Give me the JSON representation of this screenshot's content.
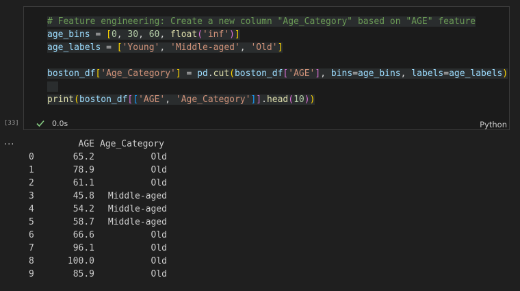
{
  "cell": {
    "execution_count": "[33]",
    "status_time": "0.0s",
    "language": "Python",
    "code_lines": [
      [
        {
          "t": "# Feature engineering: Create a new column \"Age_Category\" based on \"AGE\" feature",
          "c": "c-comment hl"
        }
      ],
      [
        {
          "t": "age_bins",
          "c": "c-var hl"
        },
        {
          "t": " = ",
          "c": "c-op hl"
        },
        {
          "t": "[",
          "c": "c-br1 hl"
        },
        {
          "t": "0",
          "c": "c-num hl"
        },
        {
          "t": ", ",
          "c": "c-op hl"
        },
        {
          "t": "30",
          "c": "c-num hl"
        },
        {
          "t": ", ",
          "c": "c-op hl"
        },
        {
          "t": "60",
          "c": "c-num hl"
        },
        {
          "t": ", ",
          "c": "c-op hl"
        },
        {
          "t": "float",
          "c": "c-fn hl"
        },
        {
          "t": "(",
          "c": "c-br2 hl"
        },
        {
          "t": "'inf'",
          "c": "c-str hl"
        },
        {
          "t": ")",
          "c": "c-br2 hl"
        },
        {
          "t": "]",
          "c": "c-br1 hl"
        }
      ],
      [
        {
          "t": "age_labels",
          "c": "c-var hl"
        },
        {
          "t": " = ",
          "c": "c-op hl"
        },
        {
          "t": "[",
          "c": "c-br1 hl"
        },
        {
          "t": "'Young'",
          "c": "c-str hl"
        },
        {
          "t": ", ",
          "c": "c-op hl"
        },
        {
          "t": "'Middle-aged'",
          "c": "c-str hl"
        },
        {
          "t": ", ",
          "c": "c-op hl"
        },
        {
          "t": "'Old'",
          "c": "c-str hl"
        },
        {
          "t": "]",
          "c": "c-br1 hl"
        }
      ],
      [
        {
          "t": "",
          "c": ""
        }
      ],
      [
        {
          "t": "boston_df",
          "c": "c-var hl"
        },
        {
          "t": "[",
          "c": "c-br1 hl"
        },
        {
          "t": "'Age_Category'",
          "c": "c-str hl"
        },
        {
          "t": "]",
          "c": "c-br1 hl"
        },
        {
          "t": " = ",
          "c": "c-op hl"
        },
        {
          "t": "pd",
          "c": "c-var hl"
        },
        {
          "t": ".",
          "c": "c-op hl"
        },
        {
          "t": "cut",
          "c": "c-fn hl"
        },
        {
          "t": "(",
          "c": "c-br1 hl"
        },
        {
          "t": "boston_df",
          "c": "c-var hl"
        },
        {
          "t": "[",
          "c": "c-br2 hl"
        },
        {
          "t": "'AGE'",
          "c": "c-str hl"
        },
        {
          "t": "]",
          "c": "c-br2 hl"
        },
        {
          "t": ", ",
          "c": "c-op hl"
        },
        {
          "t": "bins",
          "c": "c-var hl"
        },
        {
          "t": "=",
          "c": "c-op hl"
        },
        {
          "t": "age_bins",
          "c": "c-var hl"
        },
        {
          "t": ", ",
          "c": "c-op hl"
        },
        {
          "t": "labels",
          "c": "c-var hl"
        },
        {
          "t": "=",
          "c": "c-op hl"
        },
        {
          "t": "age_labels",
          "c": "c-var hl"
        },
        {
          "t": ")",
          "c": "c-br1 hl"
        }
      ],
      [
        {
          "t": "  ",
          "c": "hl"
        }
      ],
      [
        {
          "t": "print",
          "c": "c-fn hl"
        },
        {
          "t": "(",
          "c": "c-br1 hl"
        },
        {
          "t": "boston_df",
          "c": "c-var hl"
        },
        {
          "t": "[",
          "c": "c-br2 hl"
        },
        {
          "t": "[",
          "c": "c-br3 hl"
        },
        {
          "t": "'AGE'",
          "c": "c-str hl"
        },
        {
          "t": ", ",
          "c": "c-op hl"
        },
        {
          "t": "'Age_Category'",
          "c": "c-str hl"
        },
        {
          "t": "]",
          "c": "c-br3 hl"
        },
        {
          "t": "]",
          "c": "c-br2 hl"
        },
        {
          "t": ".",
          "c": "c-op hl"
        },
        {
          "t": "head",
          "c": "c-fn hl"
        },
        {
          "t": "(",
          "c": "c-br2 hl"
        },
        {
          "t": "10",
          "c": "c-num hl"
        },
        {
          "t": ")",
          "c": "c-br2 hl"
        },
        {
          "t": ")",
          "c": "c-br1 hl"
        }
      ]
    ]
  },
  "output": {
    "more_label": "...",
    "headers": {
      "idx": "",
      "age": "AGE",
      "cat": "Age_Category"
    },
    "rows": [
      {
        "idx": "0",
        "age": "65.2",
        "cat": "Old"
      },
      {
        "idx": "1",
        "age": "78.9",
        "cat": "Old"
      },
      {
        "idx": "2",
        "age": "61.1",
        "cat": "Old"
      },
      {
        "idx": "3",
        "age": "45.8",
        "cat": "Middle-aged"
      },
      {
        "idx": "4",
        "age": "54.2",
        "cat": "Middle-aged"
      },
      {
        "idx": "5",
        "age": "58.7",
        "cat": "Middle-aged"
      },
      {
        "idx": "6",
        "age": "66.6",
        "cat": "Old"
      },
      {
        "idx": "7",
        "age": "96.1",
        "cat": "Old"
      },
      {
        "idx": "8",
        "age": "100.0",
        "cat": "Old"
      },
      {
        "idx": "9",
        "age": "85.9",
        "cat": "Old"
      }
    ]
  },
  "colors": {
    "check": "#89d185",
    "background": "#1f1f1f"
  }
}
